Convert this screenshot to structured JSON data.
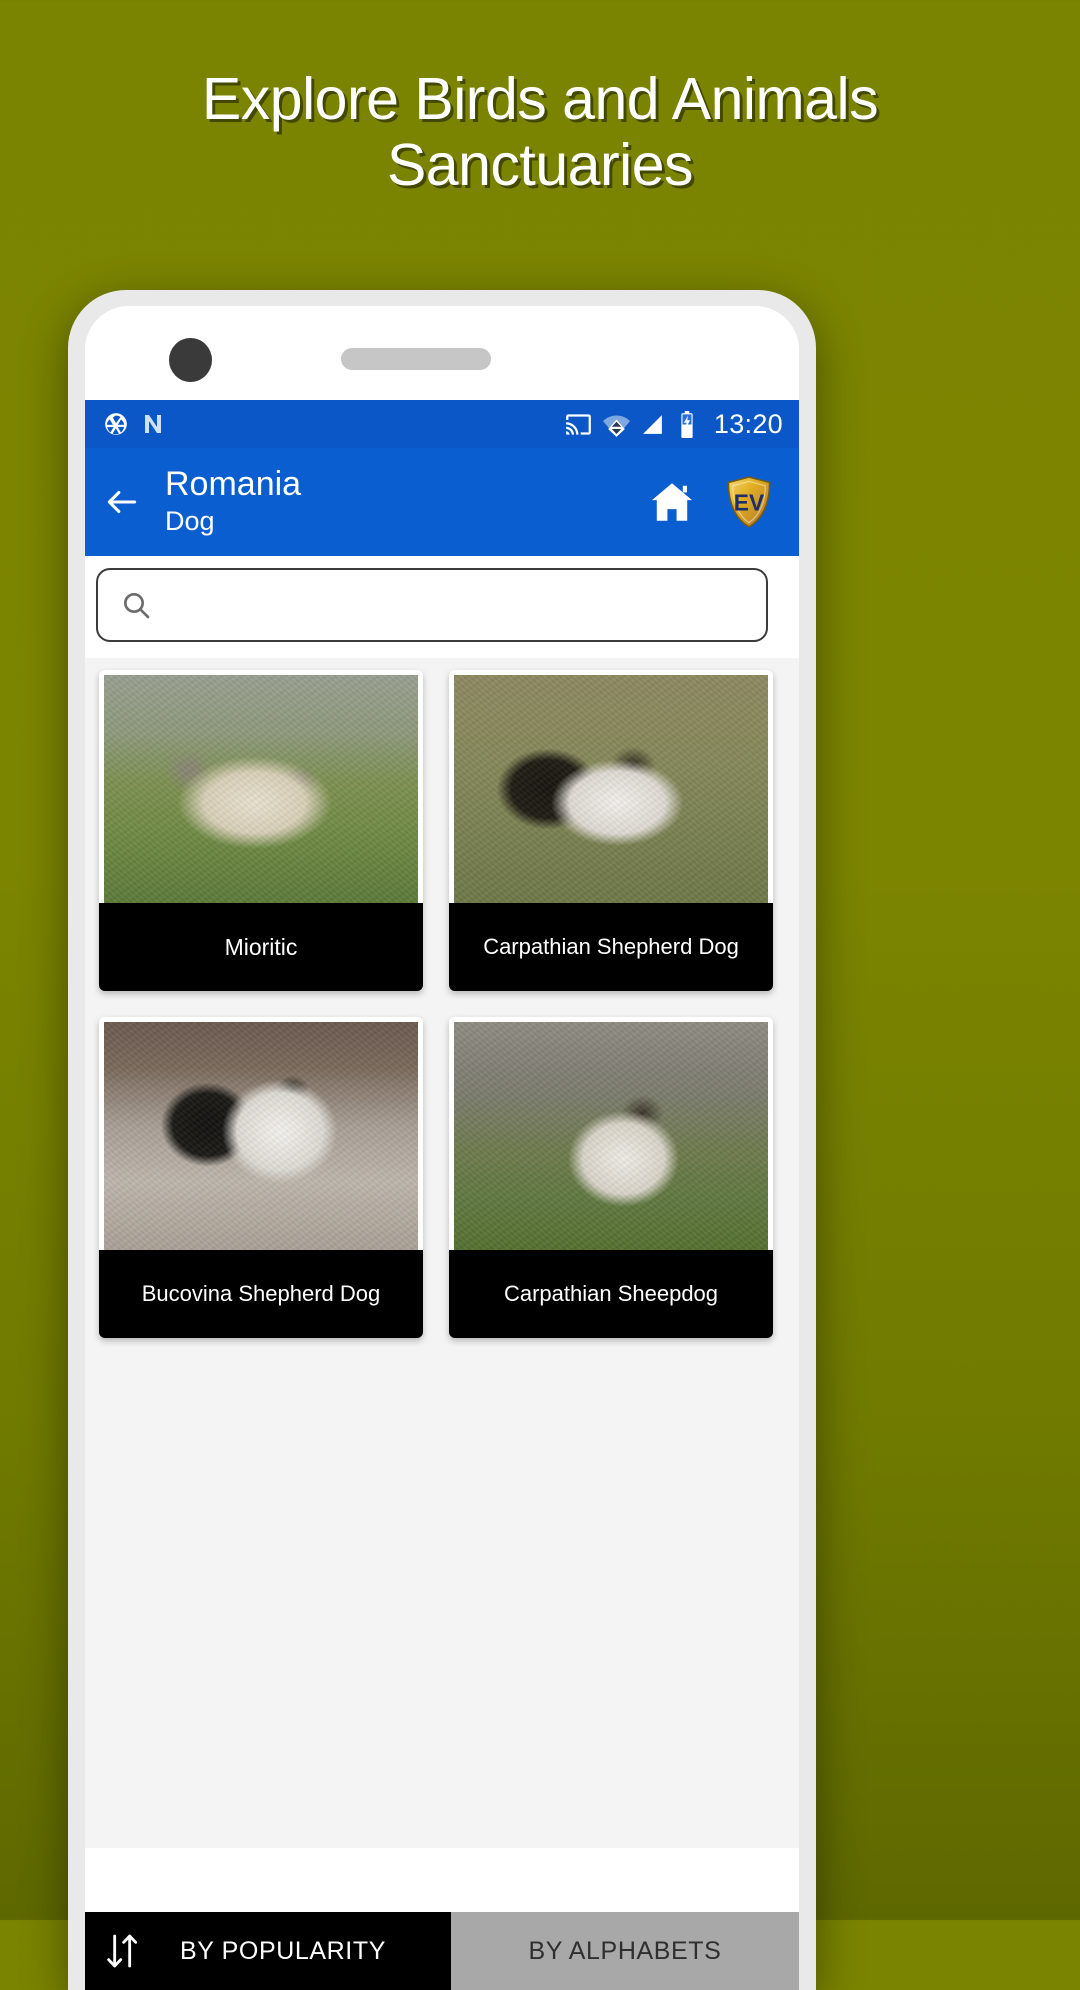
{
  "headline": {
    "line1": "Explore Birds and Animals",
    "line2": "Sanctuaries"
  },
  "colors": {
    "background_top": "#7b8400",
    "background_bottom": "#5e6800",
    "statusbar": "#0b57c7",
    "appbar": "#0b5ed0",
    "caption_bar": "#000000",
    "tab_active": "#000000",
    "tab_inactive": "#a8a8a8",
    "logo_gold": "#e0b128"
  },
  "statusbar": {
    "icons_left": [
      "camera-shutter-icon",
      "nfc-icon"
    ],
    "icons_right": [
      "cast-icon",
      "wifi-icon",
      "signal-icon",
      "battery-charging-icon"
    ],
    "clock": "13:20"
  },
  "appbar": {
    "back_icon": "back-arrow-icon",
    "title": "Romania",
    "subtitle": "Dog",
    "home_icon": "home-icon",
    "logo_text": "EV",
    "logo_icon": "shield-logo-icon"
  },
  "search": {
    "icon": "search-icon",
    "value": "",
    "placeholder": ""
  },
  "cards": [
    {
      "label": "Mioritic",
      "photo": "ph-mioritic"
    },
    {
      "label": "Carpathian Shepherd Dog",
      "photo": "ph-carpathian"
    },
    {
      "label": "Bucovina Shepherd Dog",
      "photo": "ph-bucovina"
    },
    {
      "label": "Carpathian Sheepdog",
      "photo": "ph-sheepdog"
    }
  ],
  "sort_tabs": {
    "icon": "sort-arrows-icon",
    "active": "BY POPULARITY",
    "inactive": "BY ALPHABETS"
  }
}
